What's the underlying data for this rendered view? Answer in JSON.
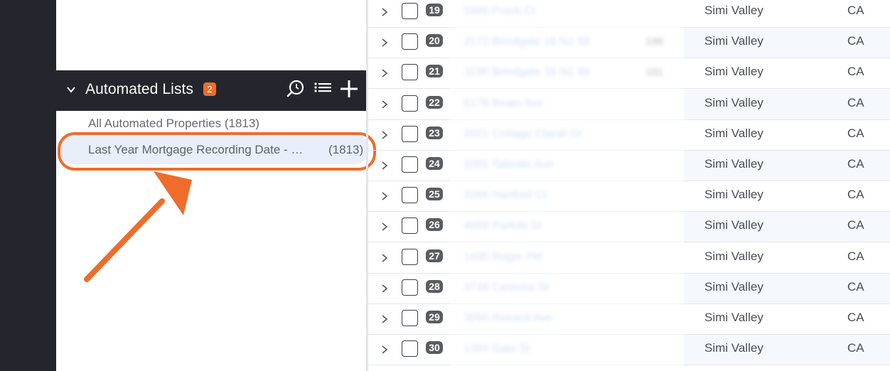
{
  "sidebar": {
    "section_title": "Automated Lists",
    "section_badge": "2",
    "icons": [
      "search-refresh-icon",
      "list-icon",
      "plus-icon"
    ],
    "lists": [
      {
        "label": "All Automated Properties (1813)"
      },
      {
        "label": "Last Year Mortgage Recording Date - …",
        "count": "(1813)",
        "selected": true
      }
    ]
  },
  "colors": {
    "accent_orange": "#ef6c2a",
    "dark_rail": "#25262d",
    "selected_bg": "#e8effb",
    "badge_gray": "#5a5c61"
  },
  "table": {
    "rows": [
      {
        "num": "19",
        "address": "5965 Fronk Ct",
        "extra": "",
        "city": "Simi Valley",
        "state": "CA"
      },
      {
        "num": "20",
        "address": "2172 Brindgate 18 N1 98",
        "extra": "198",
        "city": "Simi Valley",
        "state": "CA"
      },
      {
        "num": "21",
        "address": "3196 Brindgate 18 N1 98",
        "extra": "101",
        "city": "Simi Valley",
        "state": "CA"
      },
      {
        "num": "22",
        "address": "6178 Beam Ave",
        "extra": "",
        "city": "Simi Valley",
        "state": "CA"
      },
      {
        "num": "23",
        "address": "2021 Cottage Clarak Dr",
        "extra": "",
        "city": "Simi Valley",
        "state": "CA"
      },
      {
        "num": "24",
        "address": "3381 Tabrolle Ave",
        "extra": "",
        "city": "Simi Valley",
        "state": "CA"
      },
      {
        "num": "25",
        "address": "3396 Hanford Ct",
        "extra": "",
        "city": "Simi Valley",
        "state": "CA"
      },
      {
        "num": "26",
        "address": "4059 Parkdo Dr",
        "extra": "",
        "city": "Simi Valley",
        "state": "CA"
      },
      {
        "num": "27",
        "address": "1435 Roger Pkt",
        "extra": "",
        "city": "Simi Valley",
        "state": "CA"
      },
      {
        "num": "28",
        "address": "3734 Cerevira St",
        "extra": "",
        "city": "Simi Valley",
        "state": "CA"
      },
      {
        "num": "29",
        "address": "3096 Ronanil Ave",
        "extra": "",
        "city": "Simi Valley",
        "state": "CA"
      },
      {
        "num": "30",
        "address": "1384 Gato St",
        "extra": "",
        "city": "Simi Valley",
        "state": "CA"
      }
    ]
  }
}
